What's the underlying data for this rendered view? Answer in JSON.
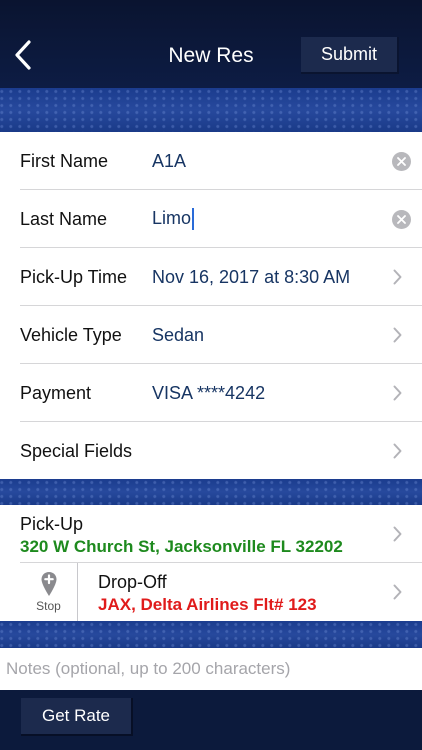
{
  "navbar": {
    "title": "New Res",
    "submit_label": "Submit",
    "back_icon": "chevron-left-icon"
  },
  "form": {
    "rows": [
      {
        "label": "First Name",
        "value": "A1A",
        "accessory": "clear-icon"
      },
      {
        "label": "Last Name",
        "value": "Limo",
        "accessory": "clear-icon",
        "focused": true
      },
      {
        "label": "Pick-Up Time",
        "value": "Nov 16, 2017 at 8:30 AM",
        "accessory": "chevron-right-icon"
      },
      {
        "label": "Vehicle Type",
        "value": "Sedan",
        "accessory": "chevron-right-icon"
      },
      {
        "label": "Payment",
        "value": "VISA ****4242",
        "accessory": "chevron-right-icon"
      },
      {
        "label": "Special Fields",
        "value": "",
        "accessory": "chevron-right-icon"
      }
    ]
  },
  "locations": {
    "pickup": {
      "title": "Pick-Up",
      "address": "320 W Church St, Jacksonville FL 32202",
      "address_color": "#1e8a1e"
    },
    "dropoff": {
      "title": "Drop-Off",
      "address": "JAX, Delta Airlines Flt# 123",
      "address_color": "#e01b1b",
      "stop_label": "Stop",
      "stop_icon": "map-pin-add-icon"
    }
  },
  "notes": {
    "placeholder": "Notes (optional, up to 200 characters)",
    "value": ""
  },
  "bottom": {
    "get_rate_label": "Get Rate"
  },
  "colors": {
    "navbar_bg": "#0c1a3c",
    "value_text": "#173563",
    "band_blue": "#27499d"
  }
}
